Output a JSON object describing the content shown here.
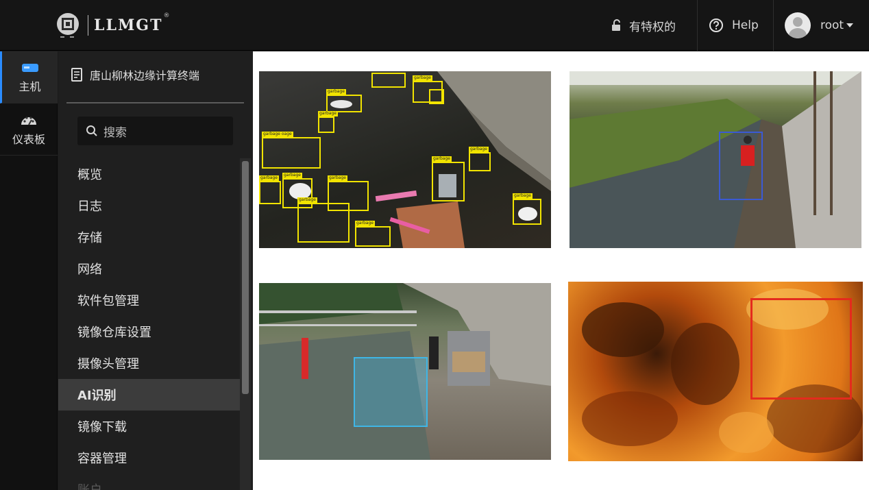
{
  "brand": {
    "name": "LLMGT",
    "registered": "®"
  },
  "topbar": {
    "privileged_label": "有特权的",
    "help_label": "Help",
    "user_name": "root"
  },
  "rail": {
    "items": [
      {
        "label": "主机",
        "icon": "server-icon",
        "active": true
      },
      {
        "label": "仪表板",
        "icon": "gauge-icon",
        "active": false
      }
    ]
  },
  "nav": {
    "host_name": "唐山柳林边缘计算终端",
    "search_placeholder": "搜索",
    "items": [
      {
        "label": "概览"
      },
      {
        "label": "日志"
      },
      {
        "label": "存储"
      },
      {
        "label": "网络"
      },
      {
        "label": "软件包管理"
      },
      {
        "label": "镜像仓库设置"
      },
      {
        "label": "摄像头管理"
      },
      {
        "label": "AI识别",
        "active": true
      },
      {
        "label": "镜像下载"
      },
      {
        "label": "容器管理"
      },
      {
        "label": "账户"
      }
    ]
  },
  "detections": {
    "garbage_label": "garbage",
    "garbage_partial_label": "garbage oage"
  },
  "colors": {
    "accent": "#2a8cff",
    "garbage_box": "#f2e400",
    "person_box": "#3b5ad4",
    "dumping_box": "#3fb6e6",
    "fire_box": "#e42b1d"
  }
}
